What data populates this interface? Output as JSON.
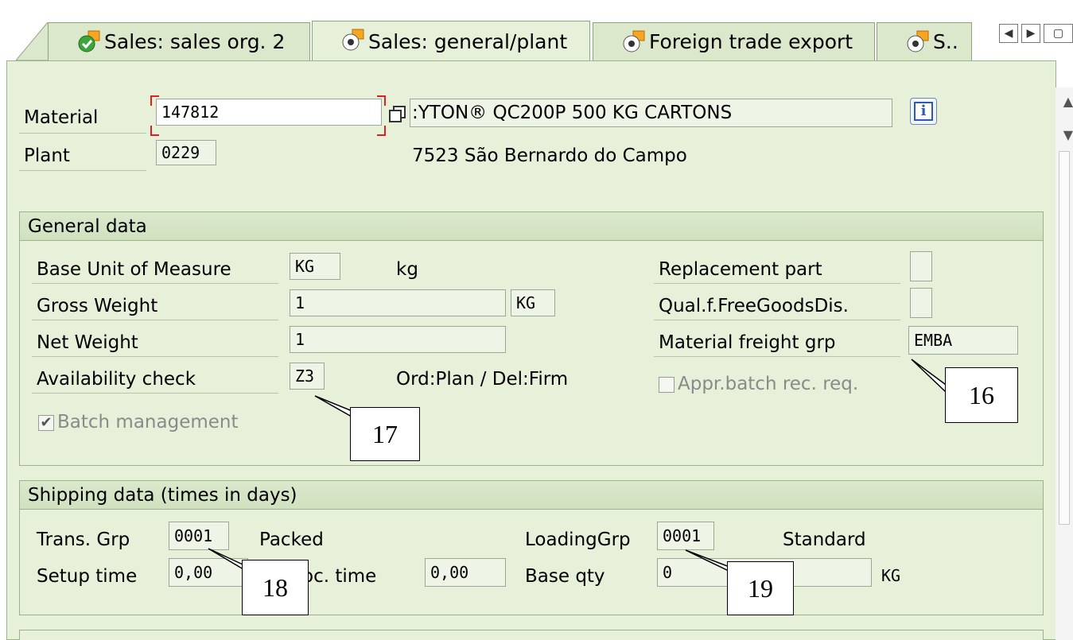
{
  "tabs": [
    {
      "label": "Sales: sales org. 2",
      "icon": "check-doc-icon"
    },
    {
      "label": "Sales: general/plant",
      "icon": "radio-doc-icon"
    },
    {
      "label": "Foreign trade export",
      "icon": "radio-doc-icon"
    },
    {
      "label": "S..",
      "icon": "radio-doc-icon"
    }
  ],
  "header": {
    "material_label": "Material",
    "material_value": "147812",
    "material_desc": ":YTON® QC200P 500 KG CARTONS",
    "plant_label": "Plant",
    "plant_value": "0229",
    "plant_desc": "7523 São Bernardo do Campo"
  },
  "general": {
    "title": "General data",
    "base_uom_label": "Base Unit of Measure",
    "base_uom_value": "KG",
    "base_uom_desc": "kg",
    "gross_label": "Gross Weight",
    "gross_value": "1",
    "gross_unit": "KG",
    "net_label": "Net Weight",
    "net_value": "1",
    "avail_label": "Availability check",
    "avail_value": "Z3",
    "avail_desc": "Ord:Plan / Del:Firm",
    "batch_label": "Batch management",
    "replacement_label": "Replacement part",
    "qual_label": "Qual.f.FreeGoodsDis.",
    "freight_label": "Material freight grp",
    "freight_value": "EMBA",
    "appr_label": "Appr.batch rec. req."
  },
  "shipping": {
    "title": "Shipping data (times in days)",
    "trans_label": "Trans. Grp",
    "trans_value": "0001",
    "trans_desc": "Packed",
    "loading_label": "LoadingGrp",
    "loading_value": "0001",
    "loading_desc": "Standard",
    "setup_label": "Setup time",
    "setup_value": "0,00",
    "proc_label": "oc. time",
    "proc_value": "0,00",
    "base_qty_label": "Base qty",
    "base_qty_value": "0",
    "base_qty_unit": "KG"
  },
  "callouts": {
    "c16": "16",
    "c17": "17",
    "c18": "18",
    "c19": "19"
  }
}
